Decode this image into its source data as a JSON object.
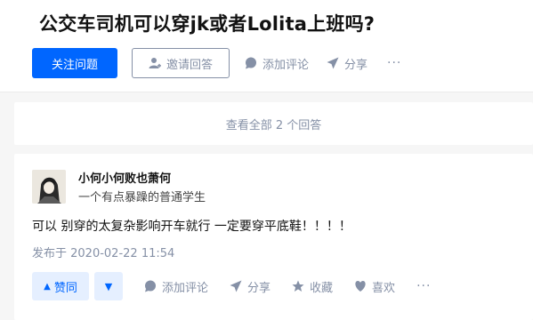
{
  "question": {
    "title": "公交车司机可以穿jk或者Lolita上班吗?",
    "follow_label": "关注问题",
    "invite_label": "邀请回答",
    "comment_label": "添加评论",
    "share_label": "分享",
    "more_label": "···"
  },
  "view_all": {
    "label": "查看全部 2 个回答"
  },
  "answer": {
    "author_name": "小何小何败也萧何",
    "author_bio": "一个有点暴躁的普通学生",
    "content": "可以 别穿的太复杂影响开车就行 一定要穿平底鞋！！！！",
    "published": "发布于 2020-02-22 11:54",
    "upvote_label": "赞同",
    "upvote_arrow": "▲",
    "downvote_arrow": "▼",
    "comment_label": "添加评论",
    "share_label": "分享",
    "collect_label": "收藏",
    "like_label": "喜欢",
    "more_label": "···"
  },
  "colors": {
    "primary": "#0066ff",
    "muted": "#8590a6",
    "vote_bg": "#e5efff",
    "page_bg": "#f6f6f6"
  }
}
